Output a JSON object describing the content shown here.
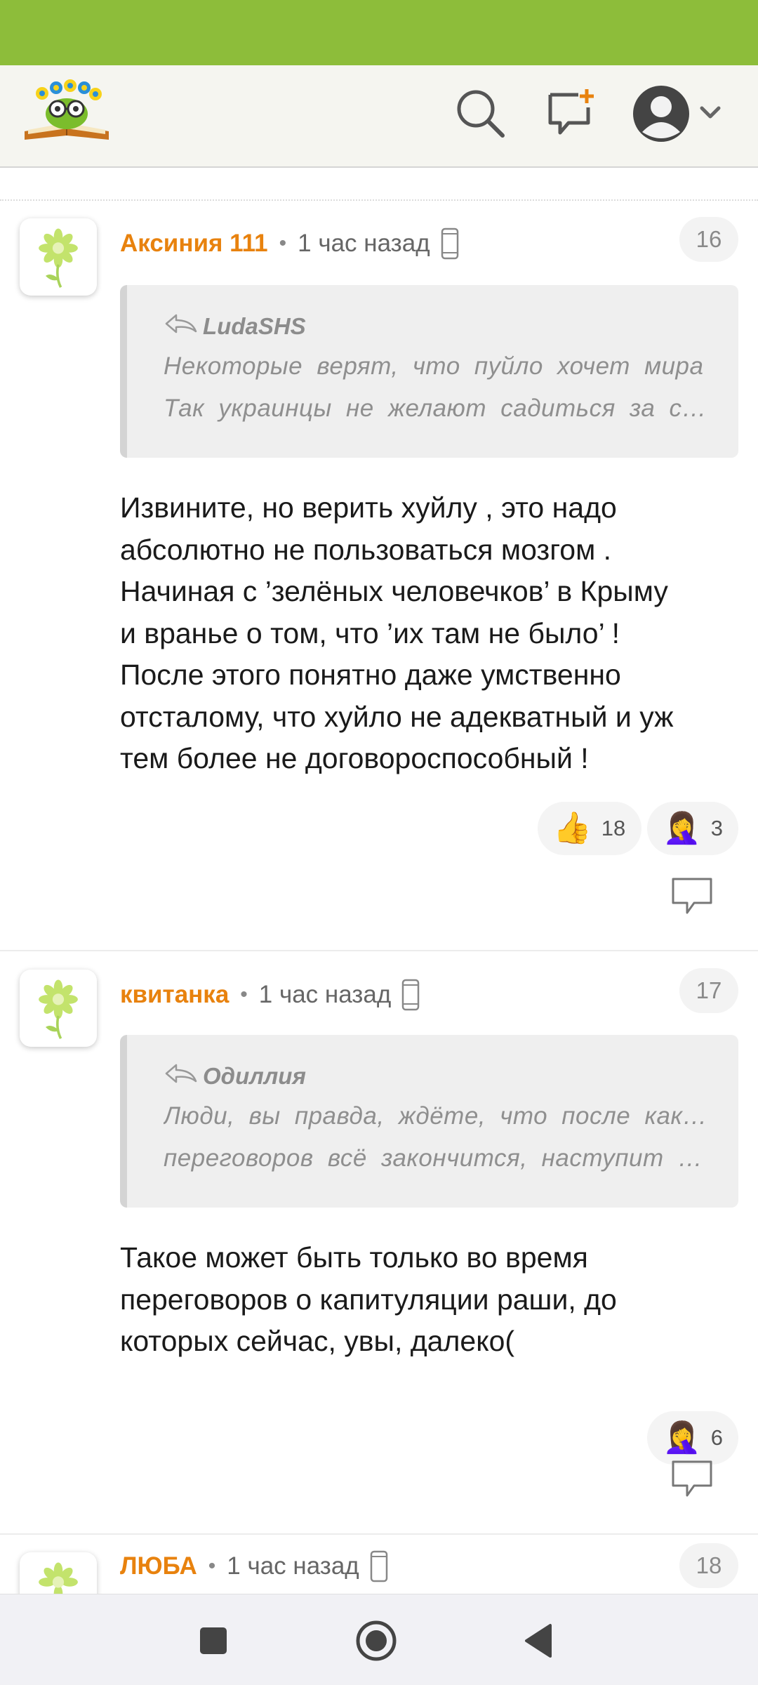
{
  "colors": {
    "status_bar": "#8dbd3a",
    "author": "#e8820e",
    "header_bg": "#f5f5f0"
  },
  "header": {
    "icons": [
      "logo",
      "search-icon",
      "new-post-icon",
      "user-icon",
      "chevron-down-icon"
    ]
  },
  "comments": [
    {
      "author": "Аксиния 111",
      "time": "1 час назад",
      "number": "16",
      "quote_author": "LudaSHS",
      "quote_lines": [
        "Некоторые верят, что пуйло хочет мира",
        "Так украинцы не желают садиться за ст..."
      ],
      "body_lines": [
        "Извините, но верить хуйлу , это надо",
        "абсолютно не пользоваться мозгом .",
        "Начиная с ’зелёных человечков’ в Крыму",
        "и вранье о том, что ’их там не было’ !",
        "После этого понятно даже умственно",
        "отсталому, что хуйло не адекватный и уж",
        "тем более не договороспособный !"
      ],
      "reactions": [
        {
          "emoji": "👍",
          "count": "18"
        },
        {
          "emoji": "🤦‍♀️",
          "count": "3"
        }
      ]
    },
    {
      "author": "квитанка",
      "time": "1 час назад",
      "number": "17",
      "quote_author": "Одиллия",
      "quote_lines": [
        "Люди, вы правда, ждёте, что после каких-то",
        "переговоров всё закончится, наступит ми..."
      ],
      "body_lines": [
        "Такое может быть только во время",
        "переговоров о капитуляции раши, до",
        "которых сейчас, увы, далеко("
      ],
      "reactions": [
        {
          "emoji": "🤦‍♀️",
          "count": "6"
        }
      ]
    },
    {
      "author": "ЛЮБА",
      "time": "1 час назад",
      "number": "18"
    }
  ],
  "navbar": {
    "icons": [
      "recent-apps-icon",
      "home-icon",
      "back-icon"
    ]
  }
}
